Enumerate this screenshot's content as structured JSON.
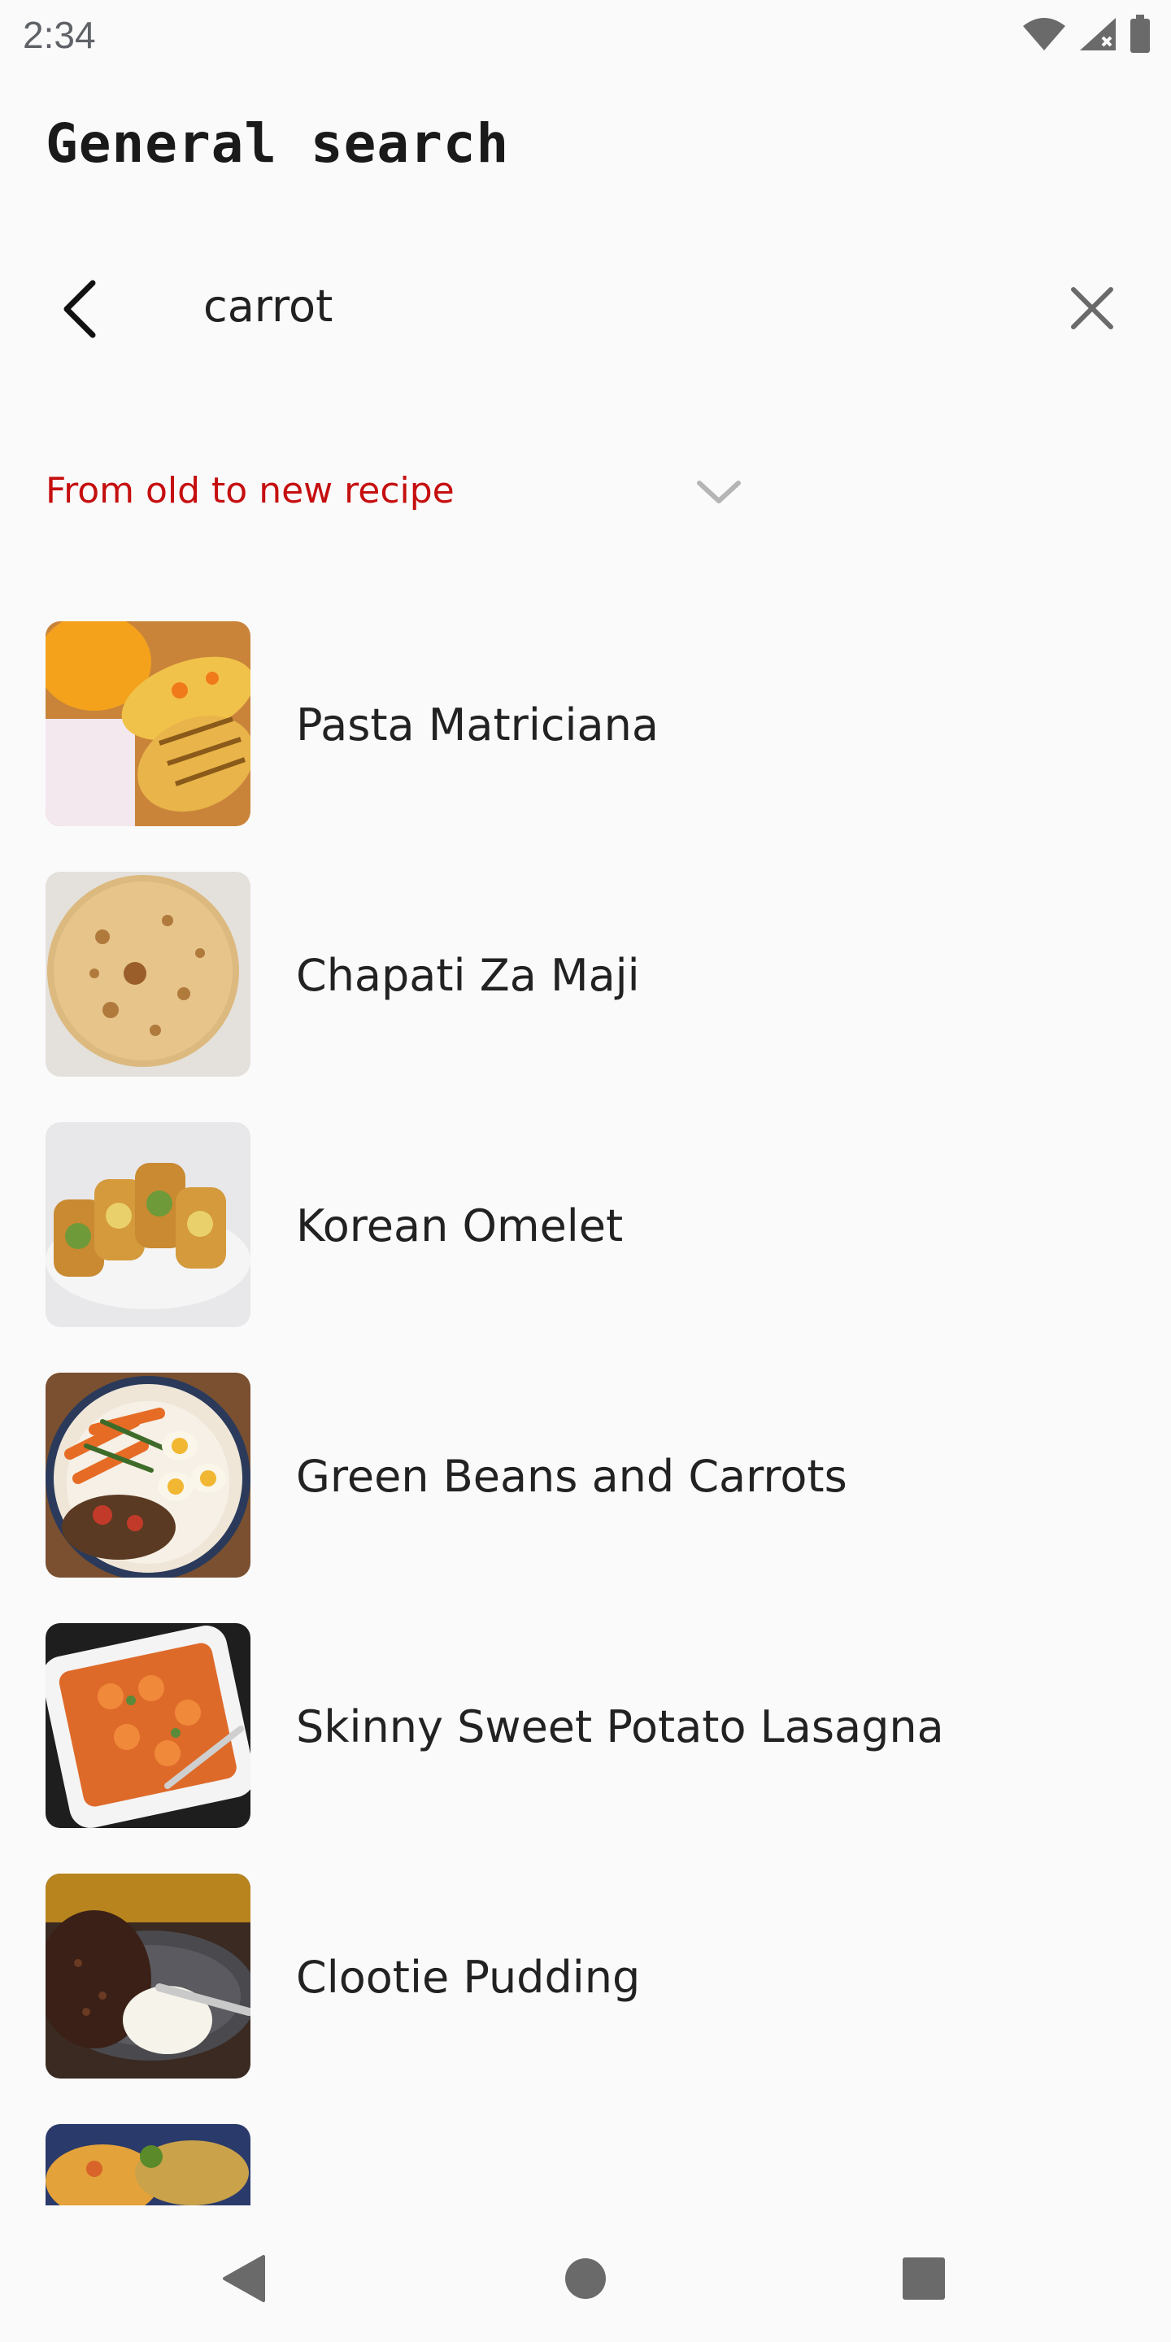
{
  "status_bar": {
    "time": "2:34",
    "icons": [
      "wifi-icon",
      "signal-icon",
      "battery-icon"
    ]
  },
  "page": {
    "title": "General search"
  },
  "search": {
    "value": "carrot",
    "back_icon": "chevron-left-icon",
    "clear_icon": "close-icon"
  },
  "sort": {
    "label": "From old to new recipe",
    "color": "#c50f0f",
    "icon": "chevron-down-icon"
  },
  "recipes": [
    {
      "name": "Pasta Matriciana"
    },
    {
      "name": "Chapati Za Maji"
    },
    {
      "name": "Korean Omelet"
    },
    {
      "name": "Green Beans and Carrots"
    },
    {
      "name": "Skinny Sweet Potato Lasagna"
    },
    {
      "name": "Clootie Pudding"
    },
    {
      "name": ""
    }
  ],
  "nav": {
    "icons": [
      "back-triangle-icon",
      "home-circle-icon",
      "recents-square-icon"
    ]
  }
}
